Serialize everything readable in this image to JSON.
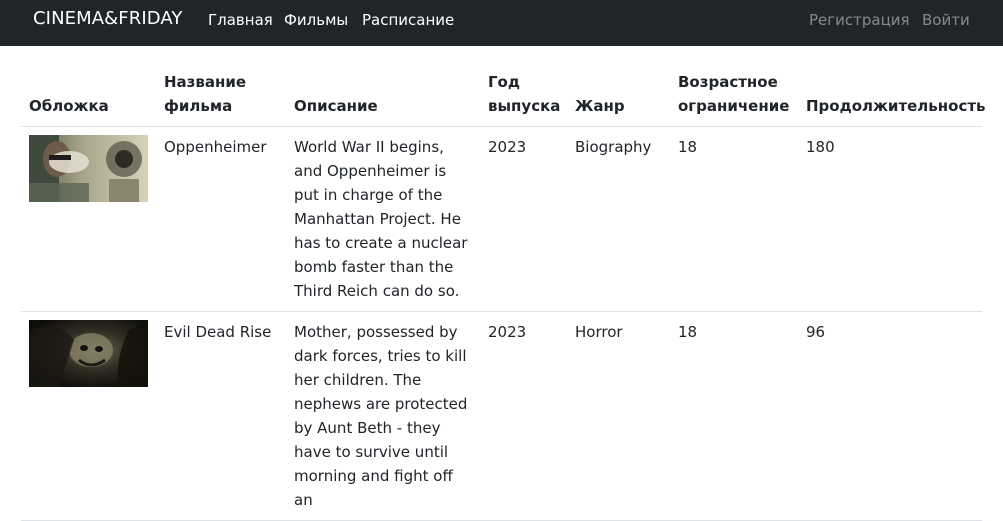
{
  "navbar": {
    "brand": "CINEMA&FRIDAY",
    "links": [
      {
        "label": "Главная"
      },
      {
        "label": "Фильмы"
      },
      {
        "label": "Расписание"
      }
    ],
    "auth": [
      {
        "label": "Регистрация"
      },
      {
        "label": "Войти"
      }
    ]
  },
  "table": {
    "headers": {
      "cover": "Обложка",
      "title": "Название фильма",
      "description": "Описание",
      "year": "Год выпуска",
      "genre": "Жанр",
      "age": "Возрастное ограничение",
      "duration": "Продолжительность"
    },
    "rows": [
      {
        "poster_icon": "oppenheimer-poster",
        "title": "Oppenheimer",
        "description": "World War II begins, and Oppenheimer is put in charge of the Manhattan Project. He has to create a nuclear bomb faster than the Third Reich can do so.",
        "year": "2023",
        "genre": "Biography",
        "age": "18",
        "duration": "180"
      },
      {
        "poster_icon": "evil-dead-rise-poster",
        "title": "Evil Dead Rise",
        "description": "Mother, possessed by dark forces, tries to kill her children. The nephews are protected by Aunt Beth - they have to survive until morning and fight off an",
        "year": "2023",
        "genre": "Horror",
        "age": "18",
        "duration": "96"
      }
    ]
  },
  "colors": {
    "navbar_bg": "#212529",
    "border": "#dee2e6",
    "text": "#212529"
  }
}
